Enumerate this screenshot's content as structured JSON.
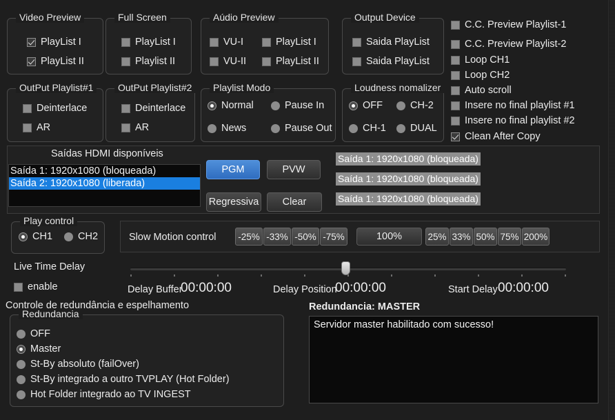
{
  "groups": {
    "video_preview": {
      "title": "Video Preview",
      "items": [
        {
          "label": "PlayList I",
          "checked": true
        },
        {
          "label": "PlayList II",
          "checked": true
        }
      ]
    },
    "full_screen": {
      "title": "Full Screen",
      "items": [
        {
          "label": "PlayList I",
          "checked": false
        },
        {
          "label": "Playlist II",
          "checked": false
        }
      ]
    },
    "audio_preview": {
      "title": "Aúdio Preview",
      "items": [
        {
          "label": "VU-I",
          "checked": false
        },
        {
          "label": "PlayList I",
          "checked": false
        },
        {
          "label": "VU-II",
          "checked": false
        },
        {
          "label": "PlayList II",
          "checked": false
        }
      ]
    },
    "output_device": {
      "title": "Output Device",
      "items": [
        {
          "label": "Saida PlayList",
          "checked": false
        },
        {
          "label": "Saida PlayList",
          "checked": false
        }
      ]
    },
    "output_playlist1": {
      "title": "OutPut Playlist#1",
      "items": [
        {
          "label": "Deinterlace",
          "checked": false
        },
        {
          "label": "AR",
          "checked": false
        }
      ]
    },
    "output_playlist2": {
      "title": "OutPut Playlist#2",
      "items": [
        {
          "label": "Deinterlace",
          "checked": false
        },
        {
          "label": "AR",
          "checked": false
        }
      ]
    },
    "playlist_modo": {
      "title": "Playlist Modo",
      "items": [
        {
          "label": "Normal",
          "selected": true
        },
        {
          "label": "Pause In",
          "selected": false
        },
        {
          "label": "News",
          "selected": false
        },
        {
          "label": "Pause Out",
          "selected": false
        }
      ]
    },
    "loudness": {
      "title": "Loudness nomalizer",
      "items": [
        {
          "label": "OFF",
          "selected": true
        },
        {
          "label": "CH-2",
          "selected": false
        },
        {
          "label": "CH-1",
          "selected": false
        },
        {
          "label": "DUAL",
          "selected": false
        }
      ]
    },
    "play_control": {
      "title": "Play control",
      "items": [
        {
          "label": "CH1",
          "selected": true
        },
        {
          "label": "CH2",
          "selected": false
        }
      ]
    },
    "redundancia": {
      "title": "Redundancia",
      "items": [
        {
          "label": "OFF",
          "selected": false
        },
        {
          "label": "Master",
          "selected": true
        },
        {
          "label": "St-By absoluto  (failOver)",
          "selected": false
        },
        {
          "label": "St-By  integrado a outro TVPLAY (Hot Folder)",
          "selected": false
        },
        {
          "label": "Hot Folder integrado ao TV INGEST",
          "selected": false
        }
      ]
    }
  },
  "options_list": [
    {
      "label": "C.C. Preview Playlist-1",
      "checked": false
    },
    {
      "label": "C.C. Preview Playlist-2",
      "checked": false
    },
    {
      "label": "Loop CH1",
      "checked": false
    },
    {
      "label": "Loop CH2",
      "checked": false
    },
    {
      "label": "Auto scroll",
      "checked": false
    },
    {
      "label": "Insere no final playlist #1",
      "checked": false
    },
    {
      "label": "Insere no final playlist #2",
      "checked": false
    },
    {
      "label": "Clean After Copy",
      "checked": true
    }
  ],
  "hdmi": {
    "title": "Saídas HDMI disponíveis",
    "list": [
      {
        "label": "Saída 1: 1920x1080  (bloqueada)",
        "selected": false
      },
      {
        "label": "Saída 2: 1920x1080  (liberada)",
        "selected": true
      }
    ],
    "buttons": {
      "pgm": "PGM",
      "pvw": "PVW",
      "regressiva": "Regressiva",
      "clear": "Clear"
    },
    "status_labels": [
      "Saída 1: 1920x1080  (bloqueada)",
      "Saída 1: 1920x1080  (bloqueada)",
      "Saída 1: 1920x1080  (bloqueada)"
    ]
  },
  "slow_motion": {
    "label": "Slow Motion control",
    "negative": [
      "-25%",
      "-33%",
      "-50%",
      "-75%"
    ],
    "normal": "100%",
    "positive": [
      "25%",
      "33%",
      "50%",
      "75%",
      "200%"
    ]
  },
  "live_time_delay": {
    "title": "Live Time Delay",
    "enable_label": "enable",
    "enable_checked": false,
    "delay_buffer_label": "Delay Buffer",
    "delay_buffer_value": "00:00:00",
    "delay_position_label": "Delay Position",
    "delay_position_value": "00:00:00",
    "start_delay_label": "Start Delay",
    "start_delay_value": "00:00:00",
    "slider_percent": 50
  },
  "redundancy_section": {
    "heading": "Controle de redundância e espelhamento",
    "status": "Redundancia: MASTER",
    "message": "Servidor master habilitado com sucesso!"
  },
  "colors": {
    "accent_blue": "#1a7fe0",
    "button_blue": "#2f6dc0",
    "background": "#1e1e1e",
    "panel": "#222222"
  }
}
